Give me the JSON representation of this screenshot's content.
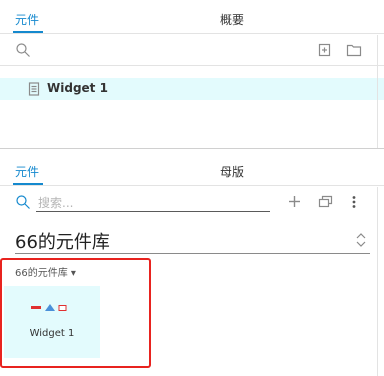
{
  "outline_panel": {
    "tabs": [
      {
        "label": "元件",
        "active": true
      },
      {
        "label": "概要",
        "active": false
      }
    ],
    "tree_items": [
      {
        "label": "Widget 1",
        "icon": "page-icon",
        "selected": true
      }
    ]
  },
  "library_panel": {
    "tabs": [
      {
        "label": "元件",
        "active": true
      },
      {
        "label": "母版",
        "active": false
      }
    ],
    "search": {
      "placeholder": "搜索..."
    },
    "library_select": {
      "value": "66的元件库"
    },
    "section_header": {
      "label": "66的元件库",
      "caret": "▾"
    },
    "widgets": [
      {
        "label": "Widget 1"
      }
    ]
  },
  "colors": {
    "accent": "#1589ce",
    "selected_row": "#e3fbfd",
    "widget_tile": "#e3fbfd",
    "highlight_box": "#e8231f"
  }
}
